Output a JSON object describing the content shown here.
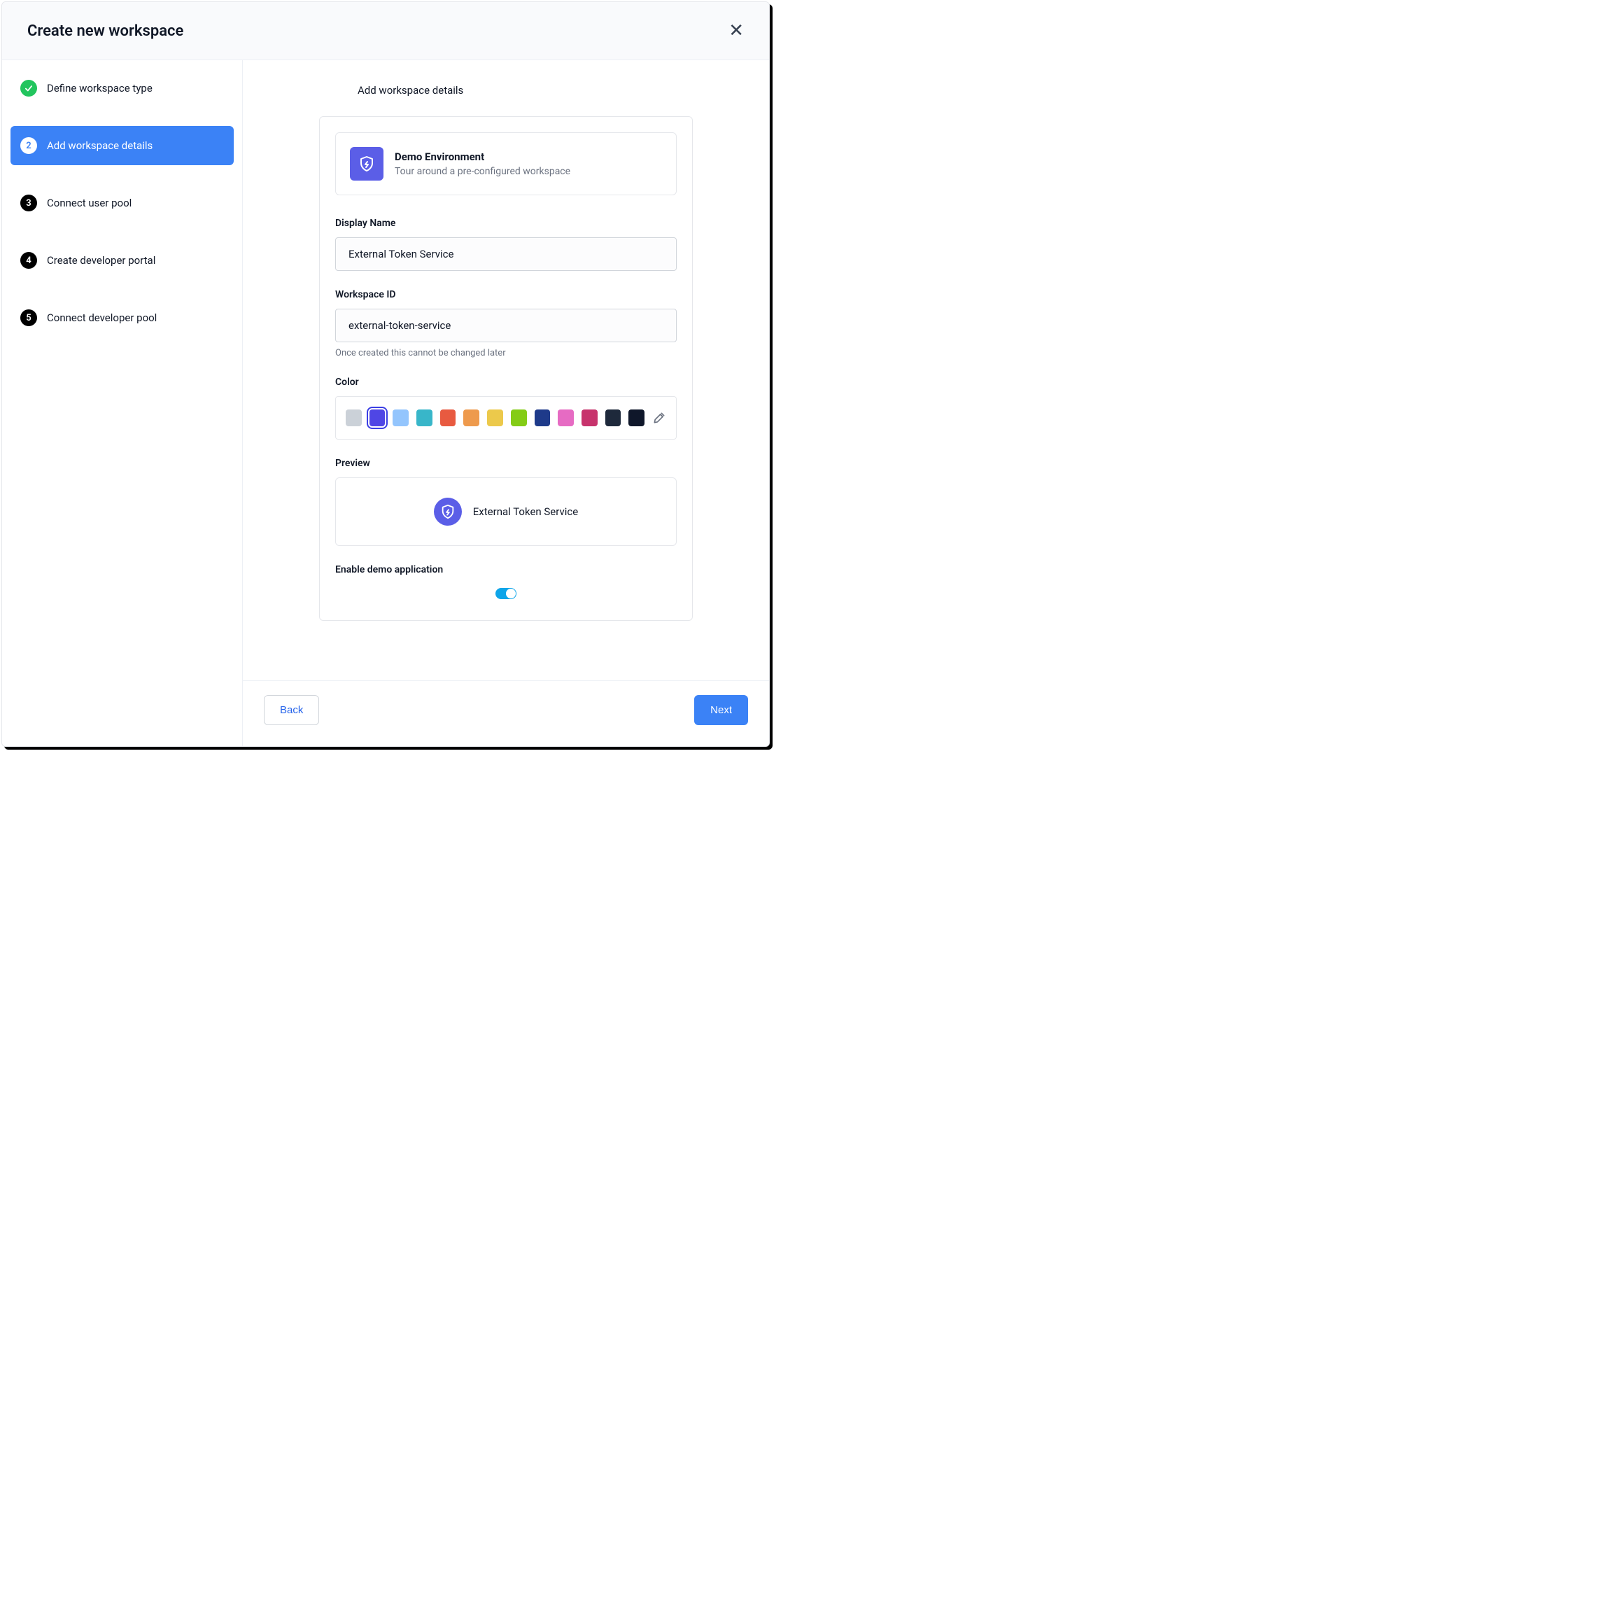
{
  "header": {
    "title": "Create new workspace"
  },
  "steps": [
    {
      "label": "Define workspace type",
      "num": "",
      "state": "completed"
    },
    {
      "label": "Add workspace details",
      "num": "2",
      "state": "active"
    },
    {
      "label": "Connect user pool",
      "num": "3",
      "state": "pending"
    },
    {
      "label": "Create developer portal",
      "num": "4",
      "state": "pending"
    },
    {
      "label": "Connect developer pool",
      "num": "5",
      "state": "pending"
    }
  ],
  "main": {
    "section_title": "Add workspace details",
    "env": {
      "title": "Demo Environment",
      "subtitle": "Tour around a pre-configured workspace"
    },
    "display_name": {
      "label": "Display Name",
      "value": "External Token Service"
    },
    "workspace_id": {
      "label": "Workspace ID",
      "value": "external-token-service",
      "helper": "Once created this cannot be changed later"
    },
    "color": {
      "label": "Color",
      "swatches": [
        {
          "hex": "#cbd1d8",
          "selected": false
        },
        {
          "hex": "#4f46e5",
          "selected": true
        },
        {
          "hex": "#93c5fd",
          "selected": false
        },
        {
          "hex": "#38b6c9",
          "selected": false
        },
        {
          "hex": "#e85a40",
          "selected": false
        },
        {
          "hex": "#ee9a4d",
          "selected": false
        },
        {
          "hex": "#ecc94b",
          "selected": false
        },
        {
          "hex": "#84cc16",
          "selected": false
        },
        {
          "hex": "#1e3a8a",
          "selected": false
        },
        {
          "hex": "#e66bc3",
          "selected": false
        },
        {
          "hex": "#c7336c",
          "selected": false
        },
        {
          "hex": "#1e293b",
          "selected": false
        },
        {
          "hex": "#0f172a",
          "selected": false
        }
      ]
    },
    "preview": {
      "label": "Preview",
      "name": "External Token Service"
    },
    "enable_demo": {
      "label": "Enable demo application",
      "on": true
    }
  },
  "footer": {
    "back": "Back",
    "next": "Next"
  }
}
